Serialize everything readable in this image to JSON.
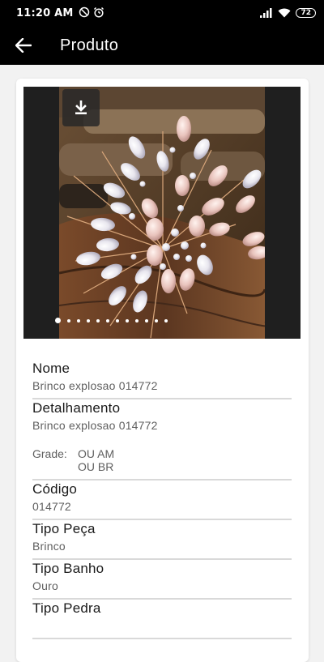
{
  "statusbar": {
    "time": "11:20 AM",
    "battery": "72"
  },
  "appbar": {
    "title": "Produto"
  },
  "gallery": {
    "page_count": 12,
    "active_page": 1
  },
  "fields": {
    "nome": {
      "label": "Nome",
      "value": "Brinco explosao 014772"
    },
    "detalhamento": {
      "label": "Detalhamento",
      "value": "Brinco explosao 014772"
    },
    "grade": {
      "label": "Grade:",
      "values": [
        "OU AM",
        "OU BR"
      ]
    },
    "codigo": {
      "label": "Código",
      "value": "014772"
    },
    "tipo_peca": {
      "label": "Tipo Peça",
      "value": "Brinco"
    },
    "tipo_banho": {
      "label": "Tipo Banho",
      "value": "Ouro"
    },
    "tipo_pedra": {
      "label": "Tipo Pedra",
      "value": ""
    }
  },
  "colors": {
    "topbar": "#000000",
    "background": "#f2f2f2",
    "card": "#ffffff",
    "divider": "#d9d9d9"
  },
  "icons": [
    "dnd-icon",
    "alarm-icon",
    "signal-icon",
    "wifi-icon",
    "battery-icon",
    "back-arrow-icon",
    "download-icon"
  ]
}
